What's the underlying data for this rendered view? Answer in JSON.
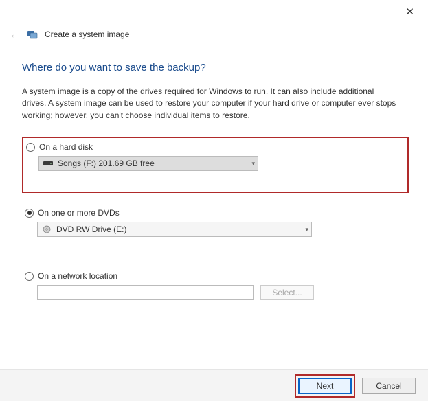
{
  "window": {
    "title": "Create a system image"
  },
  "page": {
    "heading": "Where do you want to save the backup?",
    "description": "A system image is a copy of the drives required for Windows to run. It can also include additional drives. A system image can be used to restore your computer if your hard drive or computer ever stops working; however, you can't choose individual items to restore."
  },
  "options": {
    "hard_disk": {
      "label": "On a hard disk",
      "selected": "Songs (F:)  201.69 GB free"
    },
    "dvd": {
      "label": "On one or more DVDs",
      "selected": "DVD RW Drive (E:)"
    },
    "network": {
      "label": "On a network location",
      "path": "",
      "select_button": "Select..."
    }
  },
  "footer": {
    "next": "Next",
    "cancel": "Cancel"
  }
}
